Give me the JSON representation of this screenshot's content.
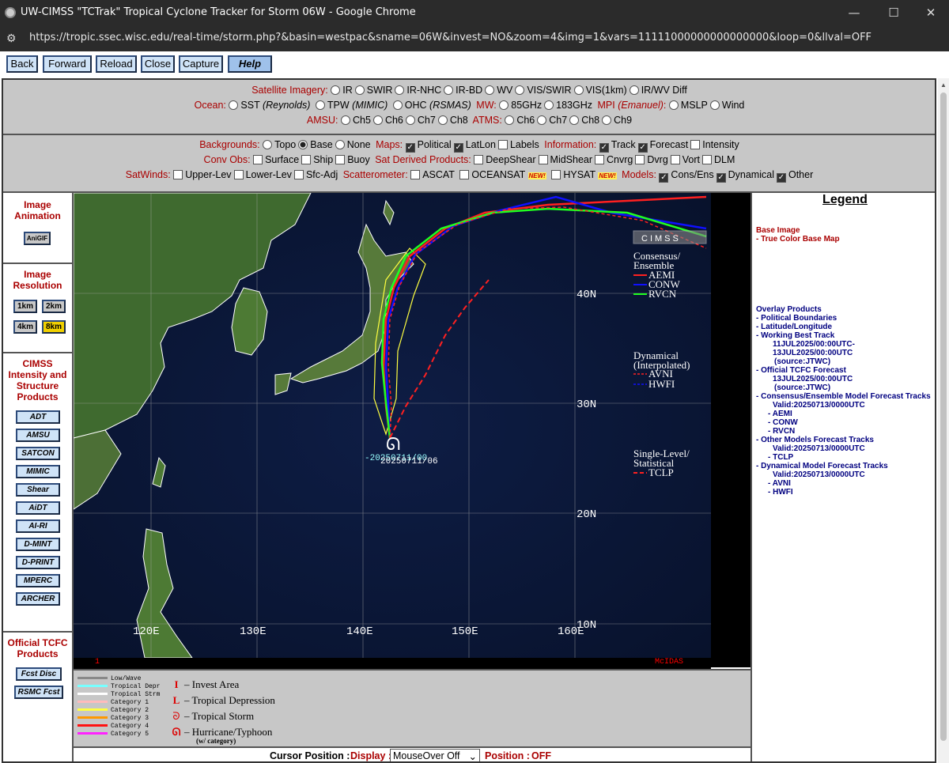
{
  "window": {
    "title": "UW-CIMSS \"TCTrak\" Tropical Cyclone Tracker for Storm 06W - Google Chrome",
    "url": "https://tropic.ssec.wisc.edu/real-time/storm.php?&basin=westpac&sname=06W&invest=NO&zoom=4&img=1&vars=11111000000000000000&loop=0&llval=OFF",
    "min": "—",
    "max": "☐",
    "close": "✕"
  },
  "nav": {
    "back": "Back",
    "forward": "Forward",
    "reload": "Reload",
    "close": "Close",
    "capture": "Capture",
    "help": "Help"
  },
  "panel1": {
    "sat_label": "Satellite Imagery:",
    "sat_opts": [
      "IR",
      "SWIR",
      "IR-NHC",
      "IR-BD",
      "WV",
      "VIS/SWIR",
      "VIS(1km)",
      "IR/WV Diff"
    ],
    "ocean_label": "Ocean:",
    "sst": "SST",
    "sst_src": "(Reynolds)",
    "tpw": "TPW",
    "tpw_src": "(MIMIC)",
    "ohc": "OHC",
    "ohc_src": "(RSMAS)",
    "mw_label": "MW:",
    "mw_opts": [
      "85GHz",
      "183GHz"
    ],
    "mpi_label": "MPI",
    "mpi_src": "(Emanuel)",
    "mpi_colon": ":",
    "mpi_opts": [
      "MSLP",
      "Wind"
    ],
    "amsu_label": "AMSU:",
    "amsu_opts": [
      "Ch5",
      "Ch6",
      "Ch7",
      "Ch8"
    ],
    "atms_label": "ATMS:",
    "atms_opts": [
      "Ch6",
      "Ch7",
      "Ch8",
      "Ch9"
    ]
  },
  "panel2": {
    "bg_label": "Backgrounds:",
    "bg_opts": [
      "Topo",
      "Base",
      "None"
    ],
    "maps_label": "Maps:",
    "maps_opts": [
      "Political",
      "LatLon",
      "Labels"
    ],
    "info_label": "Information:",
    "info_opts": [
      "Track",
      "Forecast",
      "Intensity"
    ],
    "conv_label": "Conv Obs:",
    "conv_opts": [
      "Surface",
      "Ship",
      "Buoy"
    ],
    "sdp_label": "Sat Derived Products:",
    "sdp_opts": [
      "DeepShear",
      "MidShear",
      "Cnvrg",
      "Dvrg",
      "Vort",
      "DLM"
    ],
    "satwinds_label": "SatWinds:",
    "satwinds_opts": [
      "Upper-Lev",
      "Lower-Lev",
      "Sfc-Adj"
    ],
    "scat_label": "Scatterometer:",
    "scat_opts": [
      "ASCAT",
      "OCEANSAT",
      "HYSAT"
    ],
    "new_badge": "NEW!",
    "models_label": "Models:",
    "models_opts": [
      "Cons/Ens",
      "Dynamical",
      "Other"
    ]
  },
  "left": {
    "anim_title": "Image Animation",
    "anigif": "AniGIF",
    "res_title": "Image Resolution",
    "res_opts": [
      "1km",
      "2km",
      "4km",
      "8km"
    ],
    "cimss_title": "CIMSS Intensity and Structure Products",
    "products": [
      "ADT",
      "AMSU",
      "SATCON",
      "MIMIC",
      "Shear",
      "AiDT",
      "AI-RI",
      "D-MINT",
      "D-PRINT",
      "MPERC",
      "ARCHER"
    ],
    "tcfc_title": "Official TCFC Products",
    "tcfc_btns": [
      "Fcst Disc",
      "RSMC Fcst"
    ]
  },
  "map": {
    "lat_labels": [
      "40N",
      "30N",
      "20N",
      "10N"
    ],
    "lon_labels": [
      "120E",
      "130E",
      "140E",
      "150E",
      "160E"
    ],
    "storm_label": "-20250711/00",
    "storm_label2": "20250711/06",
    "cons_title1": "Consensus/",
    "cons_title2": "Ensemble",
    "cons_items": [
      "AEMI",
      "CONW",
      "RVCN"
    ],
    "dyn_title1": "Dynamical",
    "dyn_title2": "(Interpolated)",
    "dyn_items": [
      "AVNI",
      "HWFI"
    ],
    "sl_title1": "Single-Level/",
    "sl_title2": "Statistical",
    "sl_items": [
      "TCLP"
    ],
    "frame_num": "1",
    "mcidas": "McIDAS",
    "cimss_logo": "CIMSS",
    "colors": {
      "aemi": "#ff2020",
      "conw": "#1010ff",
      "rvcn": "#20ff20",
      "avni": "#ff2020",
      "hwfi": "#1010ff",
      "tclp": "#ff2020"
    }
  },
  "keylegend": {
    "scale": [
      "Low/Wave",
      "Tropical Depr",
      "Tropical Strm",
      "Category 1",
      "Category 2",
      "Category 3",
      "Category 4",
      "Category 5"
    ],
    "symbols": [
      "– Invest Area",
      "– Tropical Depression",
      "– Tropical Storm",
      "– Hurricane/Typhoon"
    ],
    "w_cat": "(w/ category)"
  },
  "cursor": {
    "label": "Cursor Position :",
    "display_label": "Display :",
    "display_value": "MouseOver Off",
    "position_label": "Position :",
    "position_value": "OFF"
  },
  "legend": {
    "title": "Legend",
    "base_hdr": "Base Image",
    "base_item": "-  True Color Base Map",
    "overlay_hdr": "Overlay Products",
    "lines": [
      "-  Political Boundaries",
      "-  Latitude/Longitude",
      "-  Working Best Track",
      "11JUL2025/00:00UTC-",
      "13JUL2025/00:00UTC",
      "(source:JTWC)",
      "-  Official TCFC Forecast",
      "13JUL2025/00:00UTC",
      "(source:JTWC)",
      "-  Consensus/Ensemble Model Forecast Tracks",
      "Valid:20250713/0000UTC",
      "- AEMI",
      "- CONW",
      "- RVCN",
      "-  Other Models Forecast Tracks",
      "Valid:20250713/0000UTC",
      "- TCLP",
      "-  Dynamical Model Forecast Tracks",
      "Valid:20250713/0000UTC",
      "- AVNI",
      "- HWFI"
    ]
  }
}
